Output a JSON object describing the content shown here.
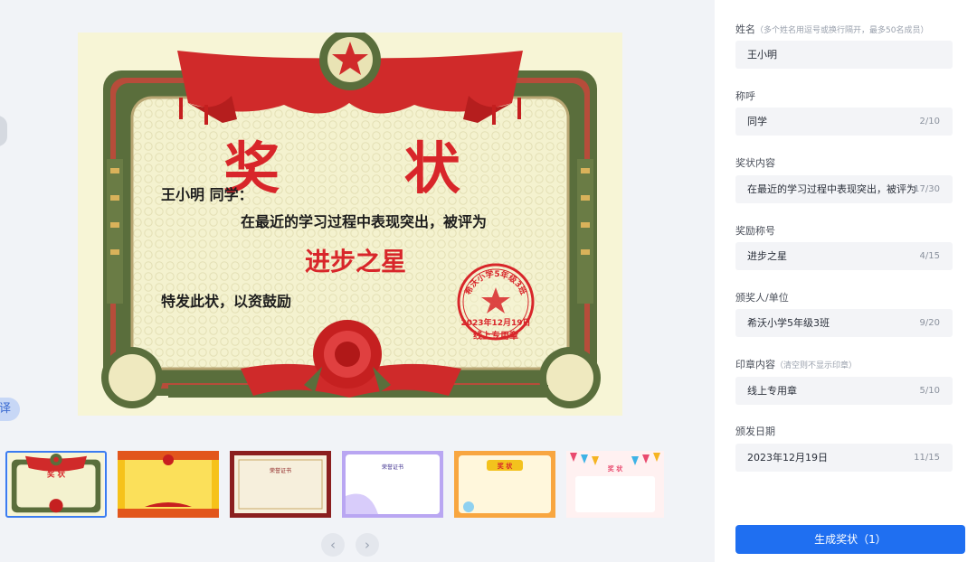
{
  "certificate": {
    "title": "奖 状",
    "name_line": "王小明 同学：",
    "body": "在最近的学习过程中表现突出，被评为",
    "award": "进步之星",
    "closing": "特发此状，以资鼓励",
    "stamp_arc": "希沃小学5年级3班",
    "stamp_date": "2023年12月19日",
    "stamp_text": "线上专用章",
    "colors": {
      "red": "#d8262a",
      "green": "#5a6e3c",
      "paper": "#f7f5d6"
    }
  },
  "left_edge_button": "译",
  "thumbnails": [
    {
      "name": "red-green-classic",
      "title": "奖 状",
      "selected": true
    },
    {
      "name": "yellow-festive",
      "title": "",
      "selected": false
    },
    {
      "name": "brown-frame",
      "title": "荣誉证书",
      "selected": false
    },
    {
      "name": "purple-modern",
      "title": "荣誉证书",
      "selected": false
    },
    {
      "name": "orange-cartoon",
      "title": "奖 状",
      "selected": false
    },
    {
      "name": "bunting-party",
      "title": "奖 状",
      "selected": false
    }
  ],
  "nav": {
    "prev_icon": "chevron-left-icon",
    "next_icon": "chevron-right-icon"
  },
  "form": {
    "name": {
      "label": "姓名",
      "hint": "（多个姓名用逗号或换行隔开，最多50名成员）",
      "value": "王小明",
      "count": ""
    },
    "title_field": {
      "label": "称呼",
      "value": "同学",
      "count": "2/10"
    },
    "content": {
      "label": "奖状内容",
      "value": "在最近的学习过程中表现突出，被评为",
      "count": "17/30"
    },
    "award": {
      "label": "奖励称号",
      "value": "进步之星",
      "count": "4/15"
    },
    "issuer": {
      "label": "颁奖人/单位",
      "value": "希沃小学5年级3班",
      "count": "9/20"
    },
    "stamp": {
      "label": "印章内容",
      "hint": "（清空则不显示印章）",
      "value": "线上专用章",
      "count": "5/10"
    },
    "date": {
      "label": "颁发日期",
      "value": "2023年12月19日",
      "count": "11/15"
    }
  },
  "submit_label": "生成奖状（1）",
  "accent_color": "#1f6ff1"
}
